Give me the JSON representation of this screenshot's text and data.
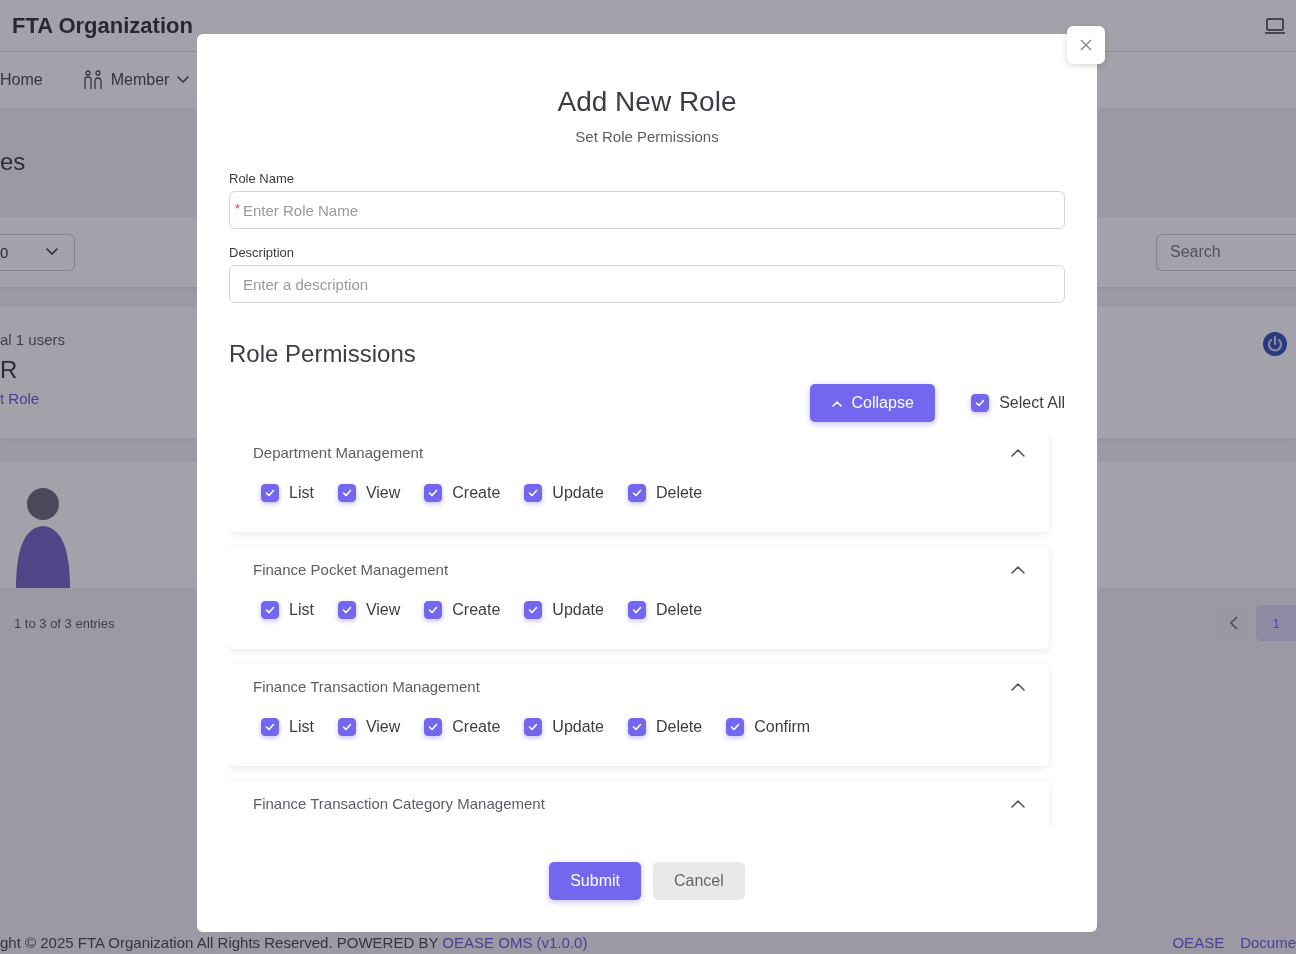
{
  "header": {
    "title": "FTA Organization"
  },
  "nav": [
    {
      "label": "Home",
      "kind": "plain"
    },
    {
      "label": "Member",
      "kind": "menu"
    }
  ],
  "page": {
    "heading": "es",
    "page_size": "0",
    "search": {
      "placeholder": "Search"
    },
    "role_card": {
      "count": "al 1 users",
      "name": "R",
      "link": "t Role"
    },
    "entries": "1 to 3 of 3 entries",
    "pages": [
      {
        "label": "1",
        "selected": true
      }
    ]
  },
  "footer": {
    "copyright": "ght © 2025 FTA Organization All Rights Reserved. POWERED BY",
    "link": "OEASE OMS (v1.0.0)",
    "links": [
      "OEASE",
      "Docume"
    ]
  },
  "modal": {
    "title": "Add New Role",
    "subtitle": "Set Role Permissions",
    "fields": [
      {
        "label": "Role Name",
        "placeholder": "Enter Role Name",
        "required_mark": "*"
      },
      {
        "label": "Description",
        "placeholder": "Enter a description"
      }
    ],
    "section_title": "Role Permissions",
    "collapse_button": "Collapse",
    "select_all": {
      "label": "Select All",
      "checked": true
    },
    "groups": [
      {
        "title": "Department Management",
        "expanded": true,
        "permissions": [
          {
            "label": "List",
            "checked": true
          },
          {
            "label": "View",
            "checked": true
          },
          {
            "label": "Create",
            "checked": true
          },
          {
            "label": "Update",
            "checked": true
          },
          {
            "label": "Delete",
            "checked": true
          }
        ]
      },
      {
        "title": "Finance Pocket Management",
        "expanded": true,
        "permissions": [
          {
            "label": "List",
            "checked": true
          },
          {
            "label": "View",
            "checked": true
          },
          {
            "label": "Create",
            "checked": true
          },
          {
            "label": "Update",
            "checked": true
          },
          {
            "label": "Delete",
            "checked": true
          }
        ]
      },
      {
        "title": "Finance Transaction Management",
        "expanded": true,
        "permissions": [
          {
            "label": "List",
            "checked": true
          },
          {
            "label": "View",
            "checked": true
          },
          {
            "label": "Create",
            "checked": true
          },
          {
            "label": "Update",
            "checked": true
          },
          {
            "label": "Delete",
            "checked": true
          },
          {
            "label": "Confirm",
            "checked": true
          }
        ]
      },
      {
        "title": "Finance Transaction Category Management",
        "expanded": true
      }
    ],
    "buttons": [
      {
        "label": "Submit",
        "kind": "primary"
      },
      {
        "label": "Cancel",
        "kind": "secondary"
      }
    ]
  }
}
